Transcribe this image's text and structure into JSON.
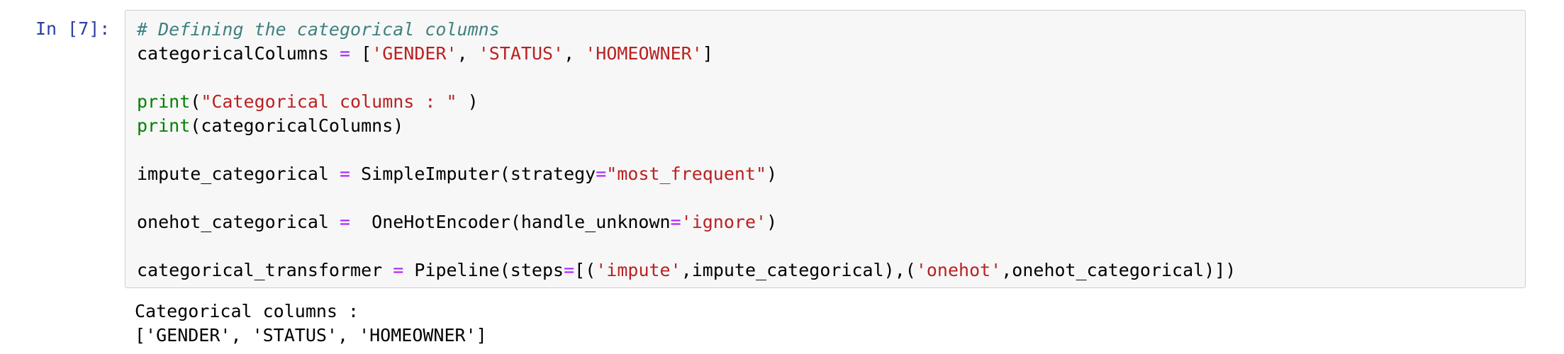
{
  "cell": {
    "prompt": "In [7]:",
    "code_lines": [
      [
        {
          "t": "# Defining the categorical columns",
          "k": "comment"
        }
      ],
      [
        {
          "t": "categoricalColumns ",
          "k": "plain"
        },
        {
          "t": "=",
          "k": "op"
        },
        {
          "t": " [",
          "k": "plain"
        },
        {
          "t": "'GENDER'",
          "k": "str"
        },
        {
          "t": ", ",
          "k": "plain"
        },
        {
          "t": "'STATUS'",
          "k": "str"
        },
        {
          "t": ", ",
          "k": "plain"
        },
        {
          "t": "'HOMEOWNER'",
          "k": "str"
        },
        {
          "t": "]",
          "k": "plain"
        }
      ],
      [],
      [
        {
          "t": "print",
          "k": "builtin"
        },
        {
          "t": "(",
          "k": "plain"
        },
        {
          "t": "\"Categorical columns : \"",
          "k": "str"
        },
        {
          "t": " )",
          "k": "plain"
        }
      ],
      [
        {
          "t": "print",
          "k": "builtin"
        },
        {
          "t": "(categoricalColumns)",
          "k": "plain"
        }
      ],
      [],
      [
        {
          "t": "impute_categorical ",
          "k": "plain"
        },
        {
          "t": "=",
          "k": "op"
        },
        {
          "t": " SimpleImputer(strategy",
          "k": "plain"
        },
        {
          "t": "=",
          "k": "op"
        },
        {
          "t": "\"most_frequent\"",
          "k": "str"
        },
        {
          "t": ")",
          "k": "plain"
        }
      ],
      [],
      [
        {
          "t": "onehot_categorical ",
          "k": "plain"
        },
        {
          "t": "=",
          "k": "op"
        },
        {
          "t": "  OneHotEncoder(handle_unknown",
          "k": "plain"
        },
        {
          "t": "=",
          "k": "op"
        },
        {
          "t": "'ignore'",
          "k": "str"
        },
        {
          "t": ")",
          "k": "plain"
        }
      ],
      [],
      [
        {
          "t": "categorical_transformer ",
          "k": "plain"
        },
        {
          "t": "=",
          "k": "op"
        },
        {
          "t": " Pipeline(steps",
          "k": "plain"
        },
        {
          "t": "=",
          "k": "op"
        },
        {
          "t": "[(",
          "k": "plain"
        },
        {
          "t": "'impute'",
          "k": "str"
        },
        {
          "t": ",impute_categorical),(",
          "k": "plain"
        },
        {
          "t": "'onehot'",
          "k": "str"
        },
        {
          "t": ",onehot_categorical)])",
          "k": "plain"
        }
      ]
    ],
    "output_lines": [
      "Categorical columns : ",
      "['GENDER', 'STATUS', 'HOMEOWNER']"
    ]
  },
  "colors": {
    "prompt": "#303F9F",
    "comment": "#408080",
    "string": "#BA2121",
    "operator": "#AA22FF",
    "builtin": "#008000",
    "cell_background": "#f7f7f7",
    "cell_border": "#cfcfcf"
  }
}
